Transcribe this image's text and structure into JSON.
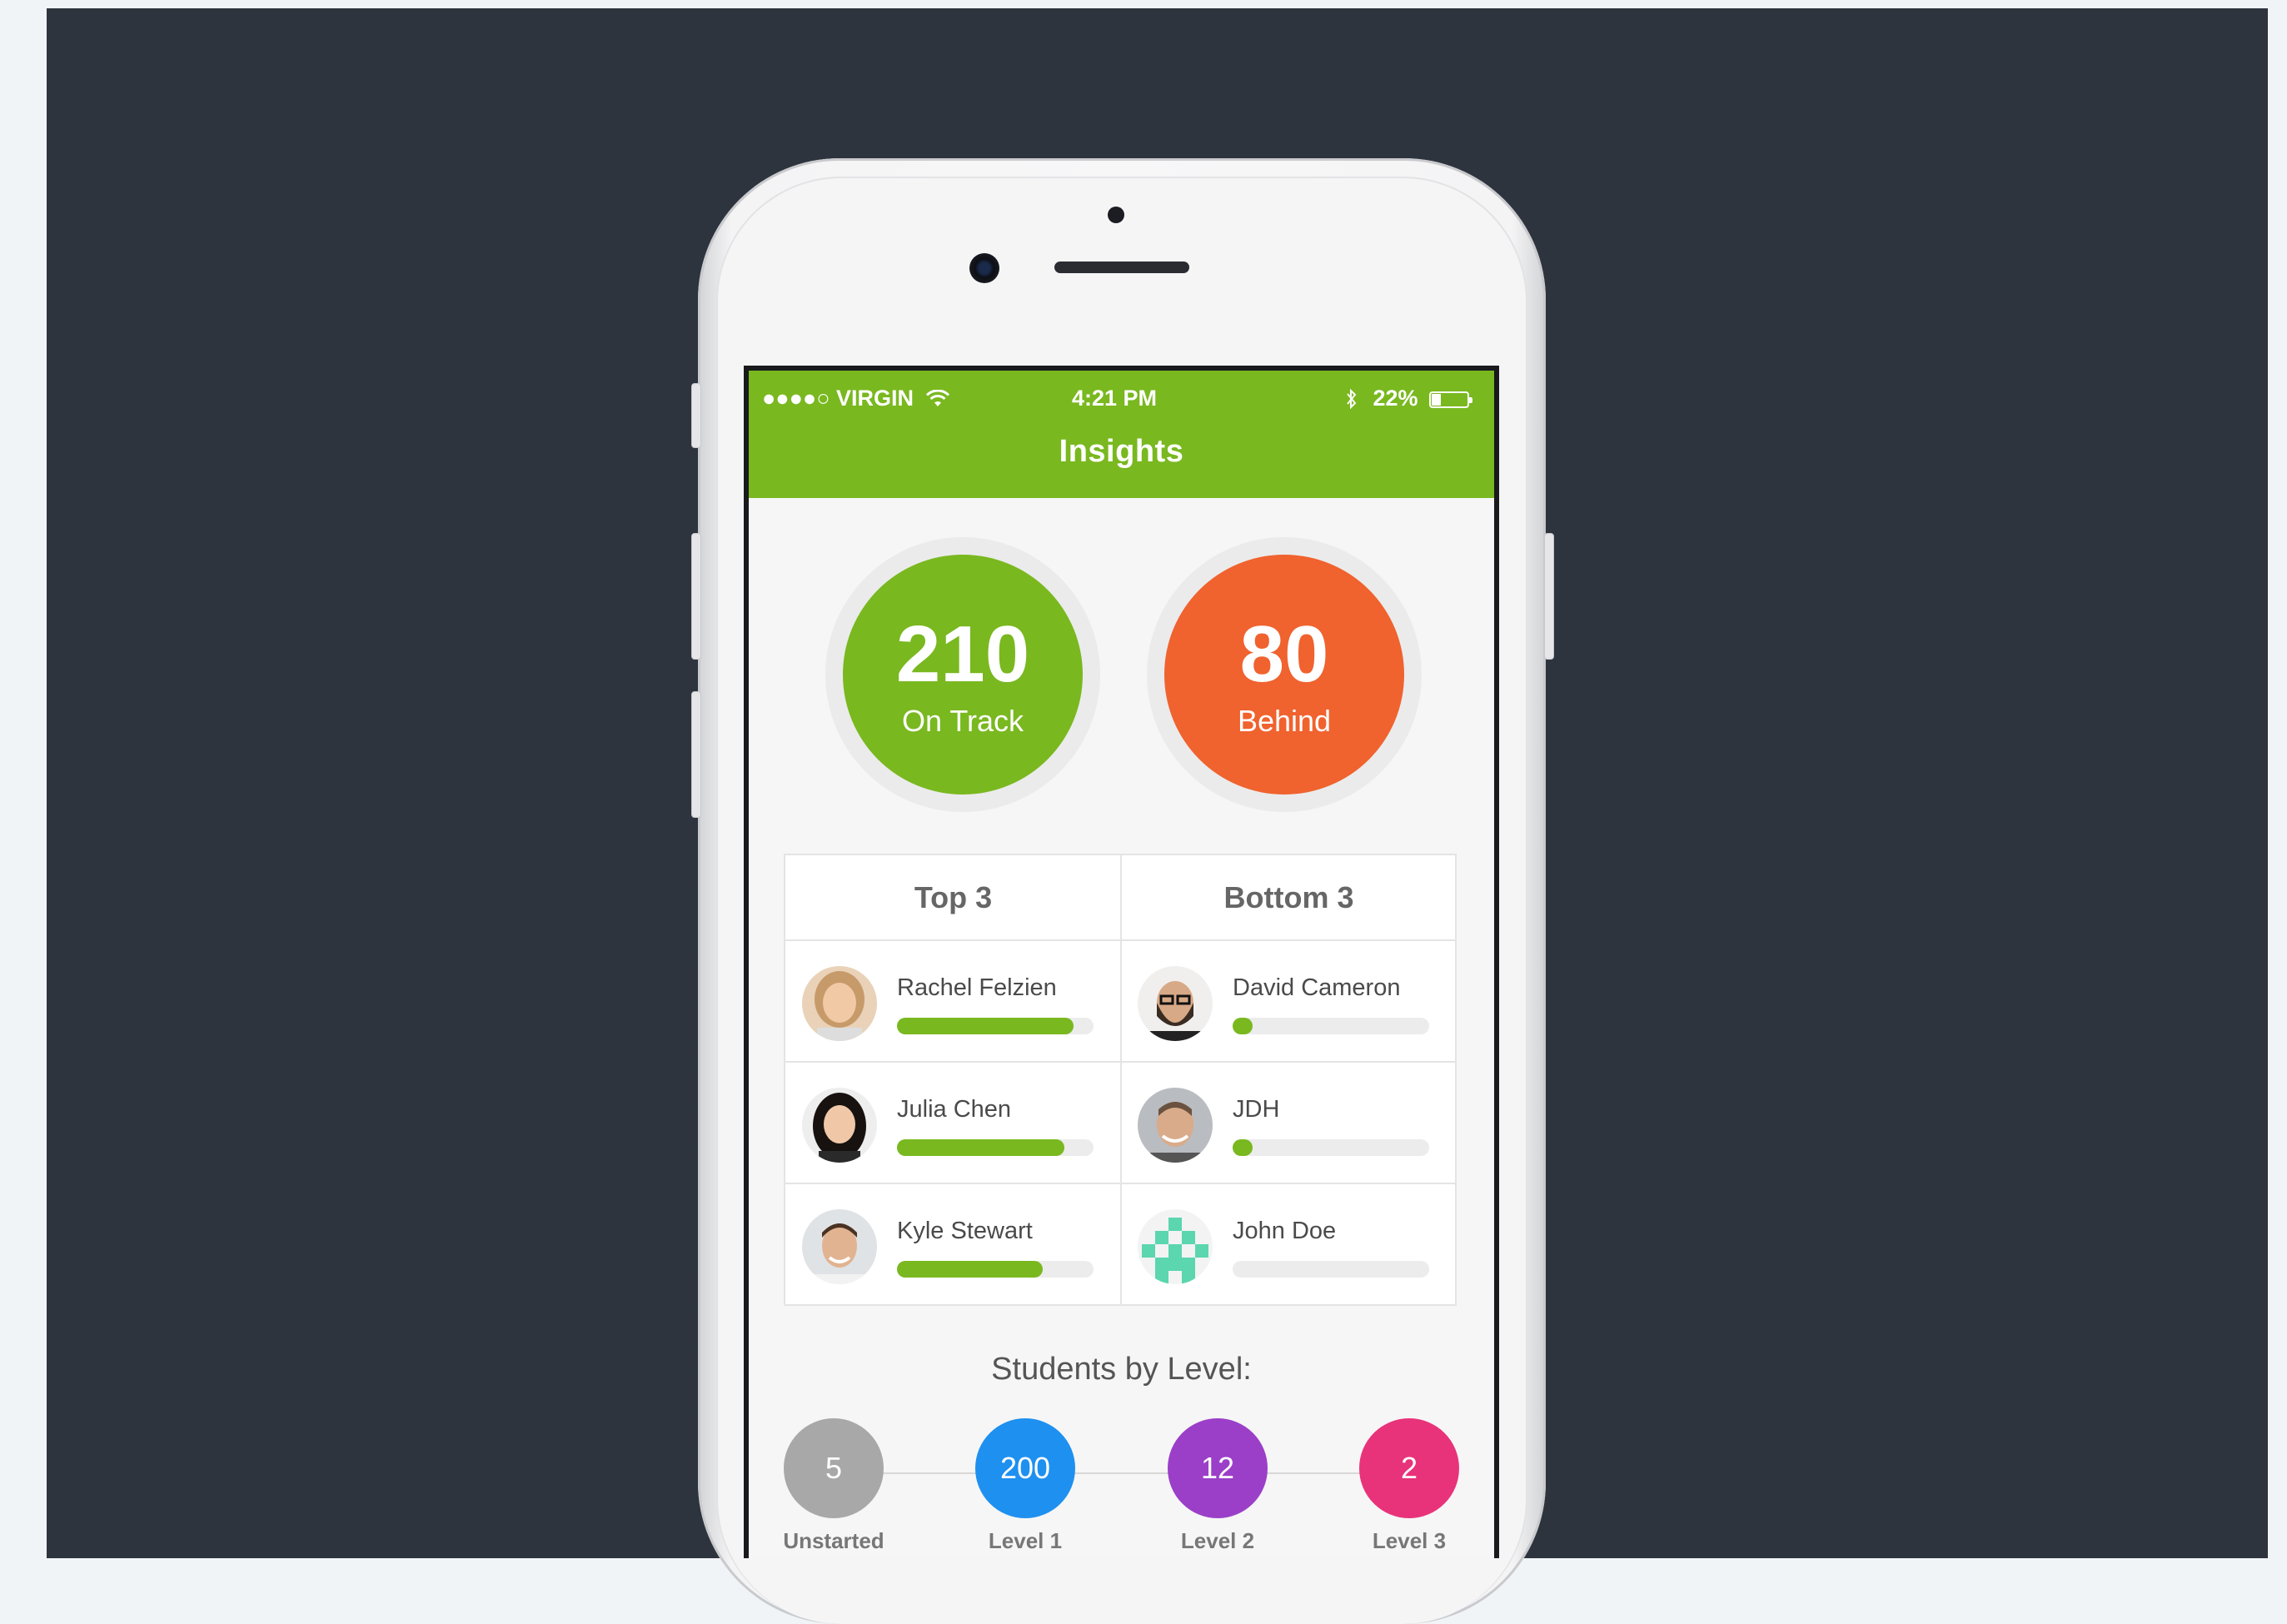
{
  "status_bar": {
    "carrier": "●●●●○ VIRGIN",
    "time": "4:21 PM",
    "battery": "22%"
  },
  "header": {
    "title": "Insights"
  },
  "stats": {
    "on_track": {
      "value": "210",
      "label": "On Track",
      "color": "#79b81f"
    },
    "behind": {
      "value": "80",
      "label": "Behind",
      "color": "#f0622e"
    }
  },
  "ranking": {
    "top_header": "Top 3",
    "bottom_header": "Bottom 3",
    "top": [
      {
        "name": "Rachel Felzien",
        "progress": 0.9
      },
      {
        "name": "Julia Chen",
        "progress": 0.85
      },
      {
        "name": "Kyle Stewart",
        "progress": 0.74
      }
    ],
    "bottom": [
      {
        "name": "David Cameron",
        "progress": 0.1
      },
      {
        "name": "JDH",
        "progress": 0.08
      },
      {
        "name": "John Doe",
        "progress": 0
      }
    ]
  },
  "levels": {
    "title": "Students by Level:",
    "items": [
      {
        "count": "5",
        "label": "Unstarted",
        "color": "#a8a8a8"
      },
      {
        "count": "200",
        "label": "Level 1",
        "color": "#1e90f0"
      },
      {
        "count": "12",
        "label": "Level 2",
        "color": "#9b3fc8"
      },
      {
        "count": "2",
        "label": "Level 3",
        "color": "#e8337a"
      }
    ]
  }
}
